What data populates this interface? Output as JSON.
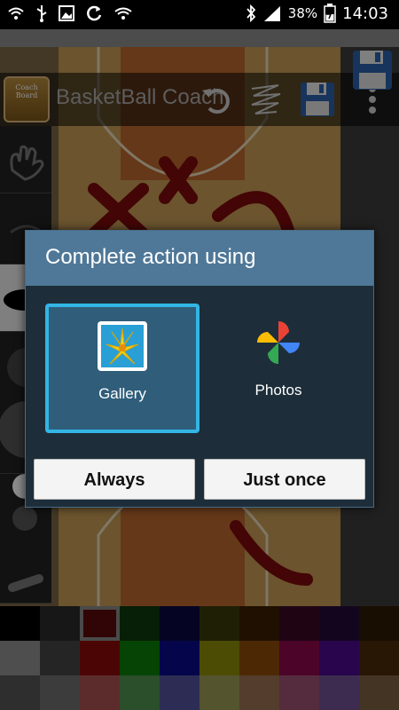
{
  "status_bar": {
    "battery_percent": "38%",
    "time": "14:03",
    "left_icons": [
      "wifi-icon",
      "usb-icon",
      "image-icon",
      "sync-icon",
      "wifi-alert-icon"
    ],
    "right_icons": [
      "bluetooth-icon",
      "signal-icon",
      "battery-icon"
    ]
  },
  "app": {
    "title": "BasketBall Coach",
    "logo_text": "Coach Board",
    "toolbar_icons": [
      "undo-icon",
      "scribble-icon",
      "save-icon",
      "more-menu-icon"
    ]
  },
  "dialog": {
    "title": "Complete action using",
    "options": [
      {
        "label": "Gallery",
        "icon": "gallery-icon",
        "selected": true
      },
      {
        "label": "Photos",
        "icon": "photos-pinwheel-icon",
        "selected": false
      }
    ],
    "buttons": {
      "always": "Always",
      "just_once": "Just once"
    },
    "accent_color": "#33b5e5",
    "header_color": "#4f7898"
  },
  "palette": {
    "colors": [
      [
        "#000000",
        "#2a2a2a",
        "#5a0a0a",
        "#0b3a0b",
        "#0a0a40",
        "#3a3a0a",
        "#3a1e05",
        "#3a0a25",
        "#250a3a",
        "#2e1a05"
      ],
      [
        "#8f8f8f",
        "#444444",
        "#8b0a0a",
        "#0a7d0a",
        "#0a0a8b",
        "#8b8b0a",
        "#8b4a0a",
        "#8b0a4a",
        "#4a0a8b",
        "#4a2a0a"
      ],
      [
        "#555555",
        "#6e6e6e",
        "#a85050",
        "#4f8f4f",
        "#50509a",
        "#9a9a55",
        "#9a7050",
        "#9a5070",
        "#705090",
        "#7a6040"
      ]
    ],
    "selected": "#5a0a0a"
  }
}
